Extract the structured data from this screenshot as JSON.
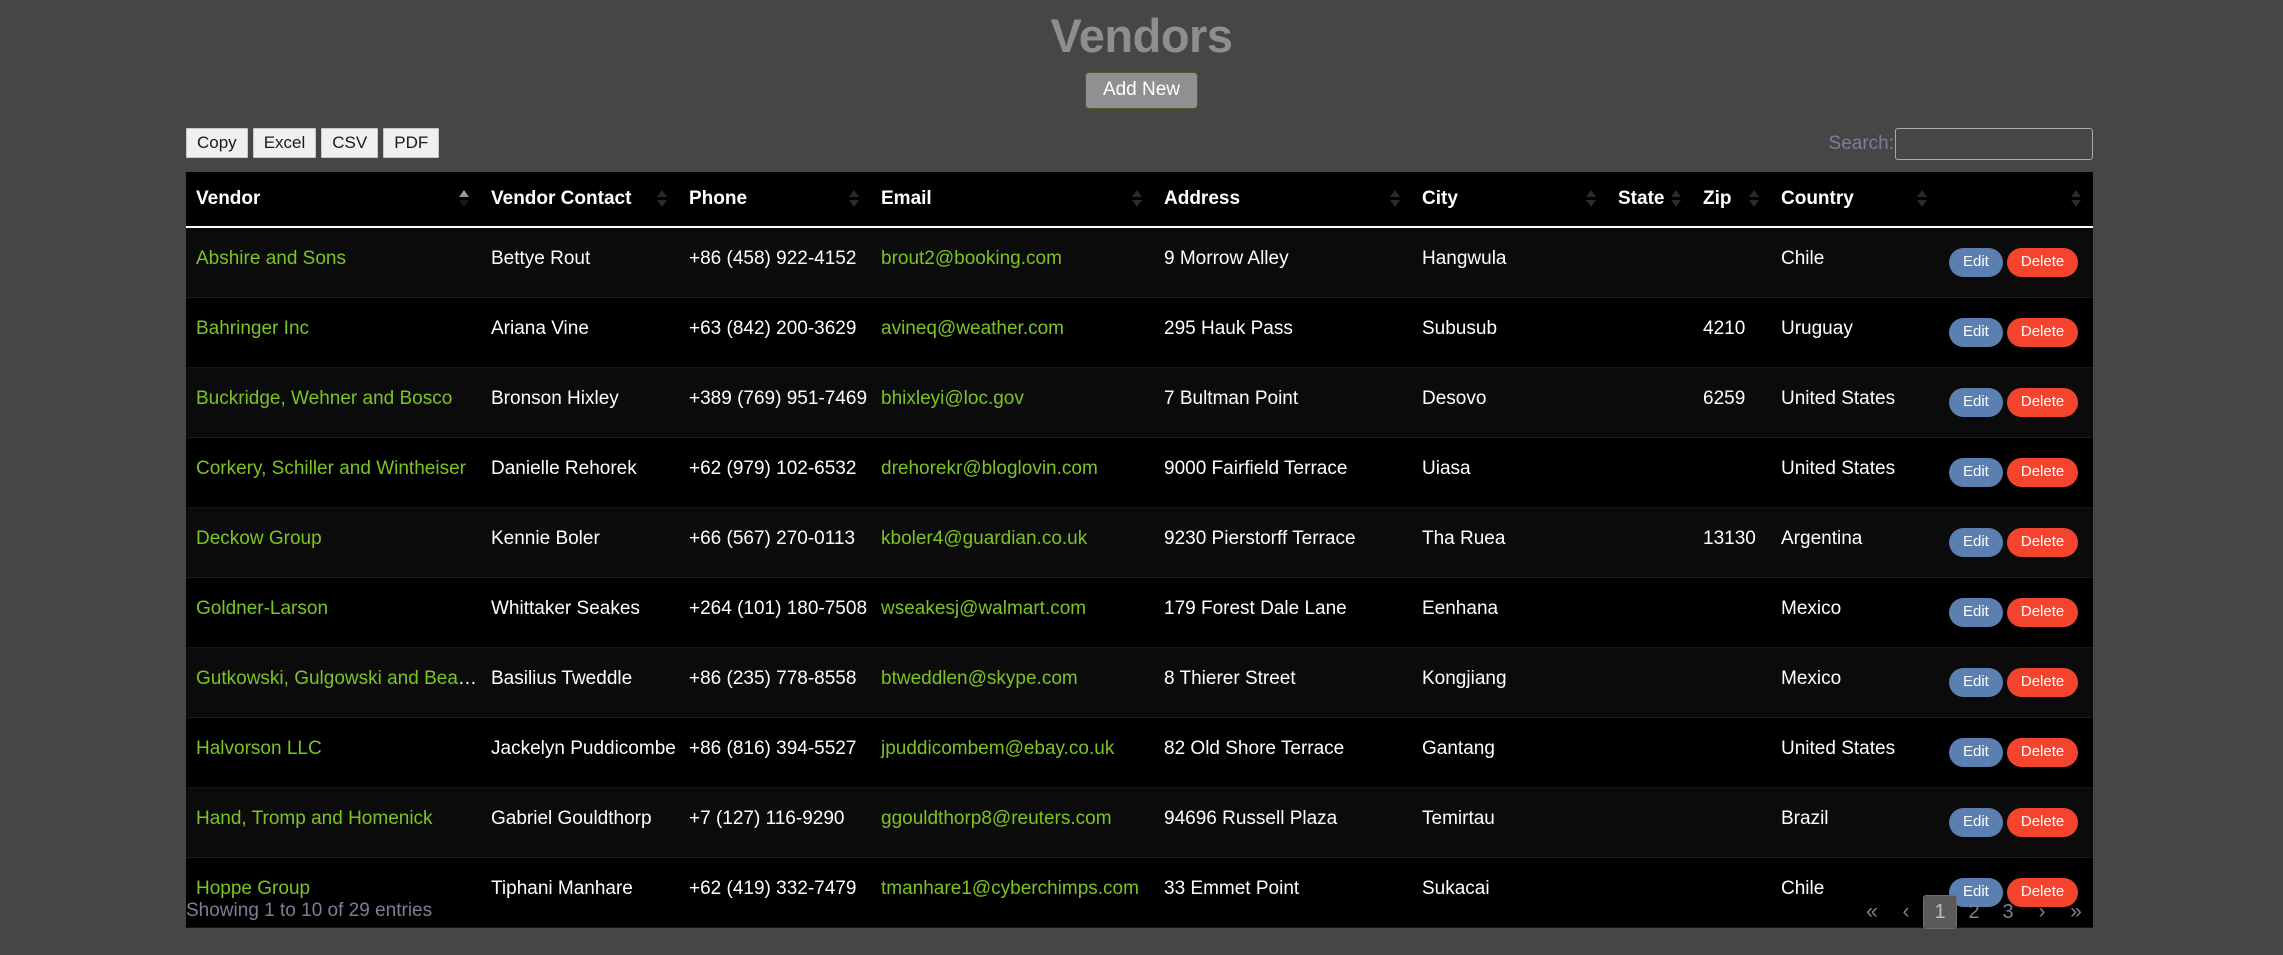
{
  "header": {
    "title": "Vendors",
    "add_new_label": "Add New"
  },
  "toolbar": {
    "export_buttons": [
      "Copy",
      "Excel",
      "CSV",
      "PDF"
    ],
    "search_label": "Search:",
    "search_value": "",
    "search_placeholder": ""
  },
  "table": {
    "columns": [
      {
        "label": "Vendor",
        "sort": "asc"
      },
      {
        "label": "Vendor Contact",
        "sort": "none"
      },
      {
        "label": "Phone",
        "sort": "none"
      },
      {
        "label": "Email",
        "sort": "none"
      },
      {
        "label": "Address",
        "sort": "none"
      },
      {
        "label": "City",
        "sort": "none"
      },
      {
        "label": "State",
        "sort": "none"
      },
      {
        "label": "Zip",
        "sort": "none"
      },
      {
        "label": "Country",
        "sort": "none"
      },
      {
        "label": "",
        "sort": "none"
      }
    ],
    "action_labels": {
      "edit": "Edit",
      "delete": "Delete"
    },
    "rows": [
      {
        "vendor": "Abshire and Sons",
        "contact": "Bettye Rout",
        "phone": "+86 (458) 922-4152",
        "email": "brout2@booking.com",
        "address": "9 Morrow Alley",
        "city": "Hangwula",
        "state": "",
        "zip": "",
        "country": "Chile"
      },
      {
        "vendor": "Bahringer Inc",
        "contact": "Ariana Vine",
        "phone": "+63 (842) 200-3629",
        "email": "avineq@weather.com",
        "address": "295 Hauk Pass",
        "city": "Subusub",
        "state": "",
        "zip": "4210",
        "country": "Uruguay"
      },
      {
        "vendor": "Buckridge, Wehner and Bosco",
        "contact": "Bronson Hixley",
        "phone": "+389 (769) 951-7469",
        "email": "bhixleyi@loc.gov",
        "address": "7 Bultman Point",
        "city": "Desovo",
        "state": "",
        "zip": "6259",
        "country": "United States"
      },
      {
        "vendor": "Corkery, Schiller and Wintheiser",
        "contact": "Danielle Rehorek",
        "phone": "+62 (979) 102-6532",
        "email": "drehorekr@bloglovin.com",
        "address": "9000 Fairfield Terrace",
        "city": "Uiasa",
        "state": "",
        "zip": "",
        "country": "United States"
      },
      {
        "vendor": "Deckow Group",
        "contact": "Kennie Boler",
        "phone": "+66 (567) 270-0113",
        "email": "kboler4@guardian.co.uk",
        "address": "9230 Pierstorff Terrace",
        "city": "Tha Ruea",
        "state": "",
        "zip": "13130",
        "country": "Argentina"
      },
      {
        "vendor": "Goldner-Larson",
        "contact": "Whittaker Seakes",
        "phone": "+264 (101) 180-7508",
        "email": "wseakesj@walmart.com",
        "address": "179 Forest Dale Lane",
        "city": "Eenhana",
        "state": "",
        "zip": "",
        "country": "Mexico"
      },
      {
        "vendor": "Gutkowski, Gulgowski and Beahan",
        "contact": "Basilius Tweddle",
        "phone": "+86 (235) 778-8558",
        "email": "btweddlen@skype.com",
        "address": "8 Thierer Street",
        "city": "Kongjiang",
        "state": "",
        "zip": "",
        "country": "Mexico"
      },
      {
        "vendor": "Halvorson LLC",
        "contact": "Jackelyn Puddicombe",
        "phone": "+86 (816) 394-5527",
        "email": "jpuddicombem@ebay.co.uk",
        "address": "82 Old Shore Terrace",
        "city": "Gantang",
        "state": "",
        "zip": "",
        "country": "United States"
      },
      {
        "vendor": "Hand, Tromp and Homenick",
        "contact": "Gabriel Gouldthorp",
        "phone": "+7 (127) 116-9290",
        "email": "ggouldthorp8@reuters.com",
        "address": "94696 Russell Plaza",
        "city": "Temirtau",
        "state": "",
        "zip": "",
        "country": "Brazil"
      },
      {
        "vendor": "Hoppe Group",
        "contact": "Tiphani Manhare",
        "phone": "+62 (419) 332-7479",
        "email": "tmanhare1@cyberchimps.com",
        "address": "33 Emmet Point",
        "city": "Sukacai",
        "state": "",
        "zip": "",
        "country": "Chile"
      }
    ]
  },
  "footer": {
    "showing_info": "Showing 1 to 10 of 29 entries",
    "pagination": [
      {
        "label": "«",
        "name": "pagination-first",
        "active": false
      },
      {
        "label": "‹",
        "name": "pagination-previous",
        "active": false
      },
      {
        "label": "1",
        "name": "pagination-page-1",
        "active": true
      },
      {
        "label": "2",
        "name": "pagination-page-2",
        "active": false
      },
      {
        "label": "3",
        "name": "pagination-page-3",
        "active": false
      },
      {
        "label": "›",
        "name": "pagination-next",
        "active": false
      },
      {
        "label": "»",
        "name": "pagination-last",
        "active": false
      }
    ]
  },
  "colors": {
    "background": "#464646",
    "table_background": "#000000",
    "link_green": "#7cc423",
    "edit_blue": "#5b7fb0",
    "delete_red": "#f4442e",
    "muted_text": "#7b7f95"
  }
}
